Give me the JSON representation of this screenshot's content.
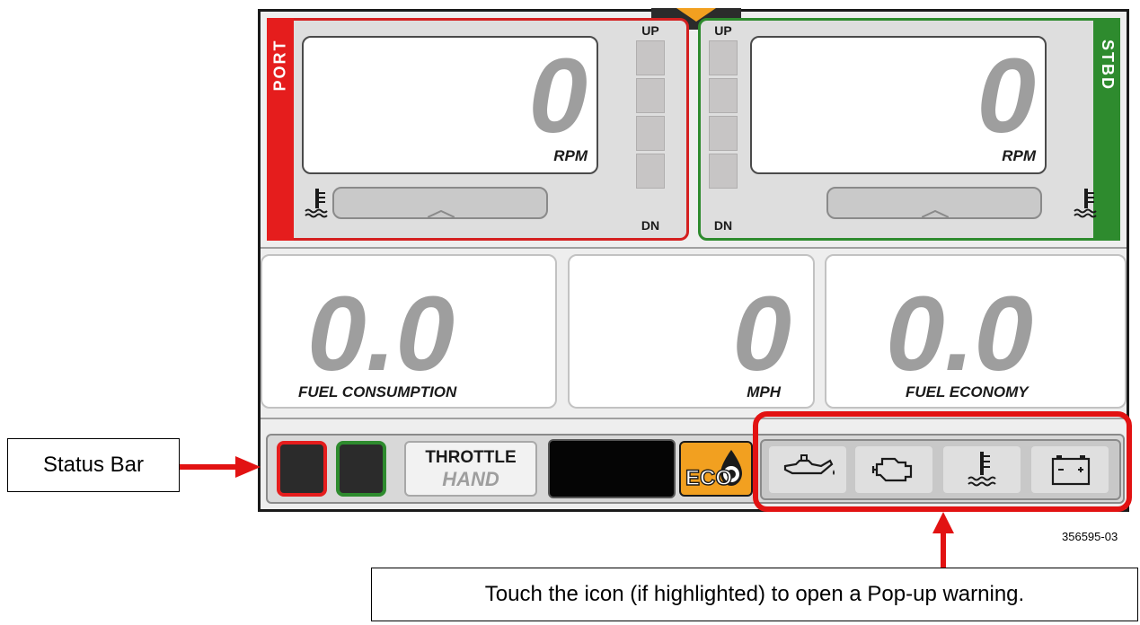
{
  "display": {
    "port": {
      "side_label": "PORT",
      "rpm_value": "0",
      "rpm_unit": "RPM",
      "trim_up": "UP",
      "trim_down": "DN",
      "color": "#e51d1d"
    },
    "stbd": {
      "side_label": "STBD",
      "rpm_value": "0",
      "rpm_unit": "RPM",
      "trim_up": "UP",
      "trim_down": "DN",
      "color": "#2e8b2e"
    },
    "gauges": [
      {
        "value": "0.0",
        "label": "FUEL CONSUMPTION"
      },
      {
        "value": "0",
        "label": "MPH"
      },
      {
        "value": "0.0",
        "label": "FUEL ECONOMY"
      }
    ],
    "status_bar": {
      "throttle_title": "THROTTLE",
      "throttle_mode": "HAND",
      "eco_label": "ECO",
      "eco_color": "#f2a020",
      "warning_icons": [
        "oil-pressure-icon",
        "check-engine-icon",
        "coolant-temperature-icon",
        "battery-icon"
      ]
    }
  },
  "annotations": {
    "status_bar_callout": "Status Bar",
    "warning_callout": "Touch the icon (if highlighted) to open a Pop-up warning.",
    "figure_code": "356595-03",
    "highlight_color": "#e21212"
  }
}
